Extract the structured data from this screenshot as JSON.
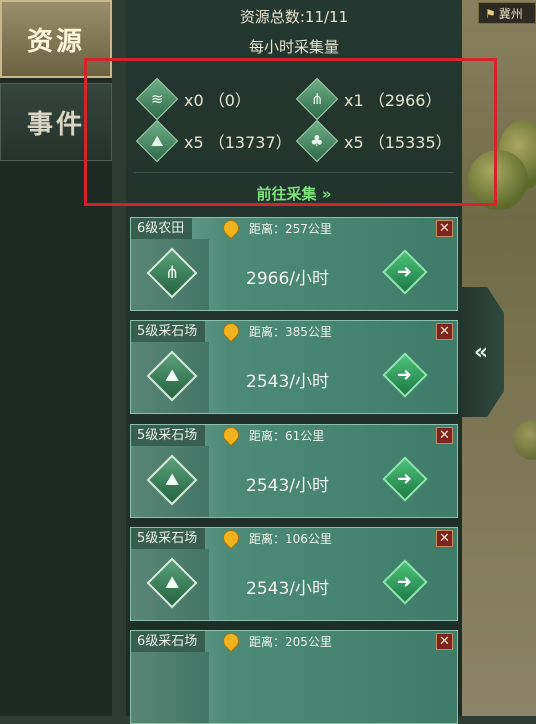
{
  "map": {
    "flag_label": "冀州"
  },
  "tabs": [
    {
      "label": "资源",
      "active": true
    },
    {
      "label": "事件",
      "active": false
    }
  ],
  "summary": {
    "total_label": "资源总数:11/11",
    "hourly_label": "每小时采集量",
    "resources": [
      {
        "icon": "grain-icon",
        "glyph": "≋",
        "text": "x0 （0）"
      },
      {
        "icon": "farmland-icon",
        "glyph": "⋔",
        "text": "x1 （2966）"
      },
      {
        "icon": "stone-icon",
        "glyph": "⛰",
        "text": "x5 （13737）"
      },
      {
        "icon": "wood-icon",
        "glyph": "♣",
        "text": "x5 （15335）"
      }
    ],
    "goto_label": "前往采集 »"
  },
  "cards": [
    {
      "title": "6级农田",
      "distance": "距离：257公里",
      "rate": "2966/小时",
      "icon": "farmland-icon",
      "glyph": "⋔"
    },
    {
      "title": "5级采石场",
      "distance": "距离：385公里",
      "rate": "2543/小时",
      "icon": "quarry-icon",
      "glyph": "⛰"
    },
    {
      "title": "5级采石场",
      "distance": "距离：61公里",
      "rate": "2543/小时",
      "icon": "quarry-icon",
      "glyph": "⛰"
    },
    {
      "title": "5级采石场",
      "distance": "距离：106公里",
      "rate": "2543/小时",
      "icon": "quarry-icon",
      "glyph": "⛰"
    },
    {
      "title": "6级采石场",
      "distance": "距离：205公里",
      "rate": "",
      "icon": "quarry-icon",
      "glyph": ""
    }
  ],
  "colors": {
    "highlight": "#d4232a",
    "accent_green": "#7ee07a",
    "close_red": "#7d241f"
  }
}
